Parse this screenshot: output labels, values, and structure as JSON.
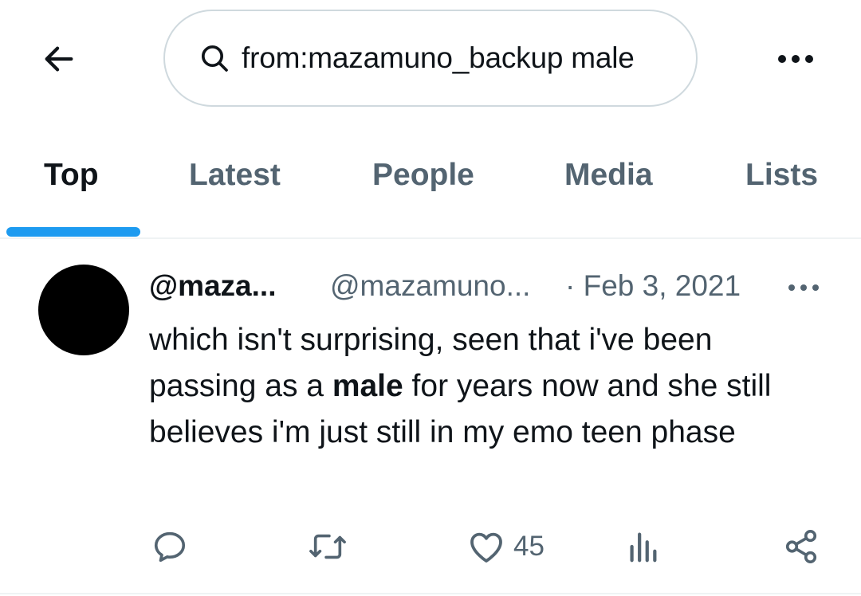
{
  "header": {
    "back_icon": "arrow-left-icon",
    "search": {
      "icon": "search-icon",
      "value": "from:mazamuno_backup male"
    },
    "more_icon": "more-horizontal-icon"
  },
  "tabs": [
    {
      "label": "Top",
      "active": true
    },
    {
      "label": "Latest",
      "active": false
    },
    {
      "label": "People",
      "active": false
    },
    {
      "label": "Media",
      "active": false
    },
    {
      "label": "Lists",
      "active": false
    }
  ],
  "tweet": {
    "display_name": "@maza...",
    "handle": "@mazamuno...",
    "date": "· Feb 3, 2021",
    "text_before": "which isn't surprising, seen that i've been passing as a ",
    "highlight": "male",
    "text_after": " for years now and she still believes i'm just still in my emo teen phase",
    "actions": {
      "reply_icon": "reply-icon",
      "retweet_icon": "retweet-icon",
      "like_icon": "heart-icon",
      "like_count": "45",
      "views_icon": "views-chart-icon",
      "share_icon": "share-icon"
    }
  },
  "colors": {
    "accent": "#1d9bf0",
    "text_primary": "#0f1419",
    "text_secondary": "#536471",
    "border": "#cfd9de"
  }
}
